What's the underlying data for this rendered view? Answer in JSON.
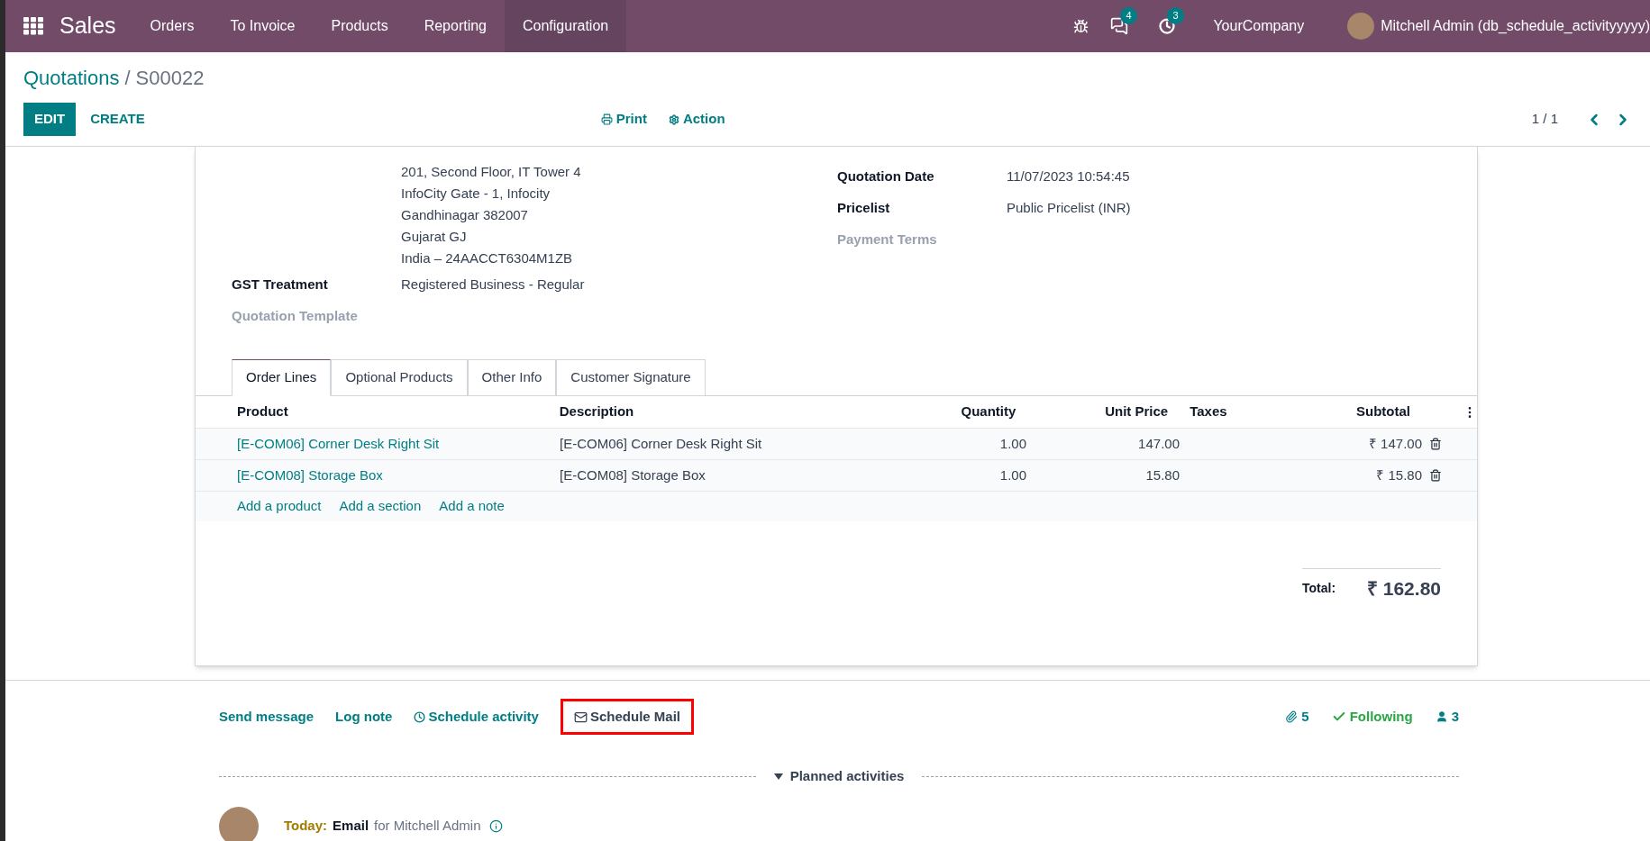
{
  "navbar": {
    "app": "Sales",
    "menu": [
      {
        "label": "Orders",
        "selected": false
      },
      {
        "label": "To Invoice",
        "selected": false
      },
      {
        "label": "Products",
        "selected": false
      },
      {
        "label": "Reporting",
        "selected": false
      },
      {
        "label": "Configuration",
        "selected": true
      }
    ],
    "messages_count": "4",
    "activities_count": "3",
    "company": "YourCompany",
    "user": "Mitchell Admin (db_schedule_activityyyyy)"
  },
  "breadcrumb": {
    "parent": "Quotations",
    "separator": "/",
    "current": "S00022"
  },
  "actions": {
    "edit": "EDIT",
    "create": "CREATE",
    "print": "Print",
    "action": "Action",
    "pager": "1 / 1"
  },
  "form": {
    "left": [
      {
        "kind": "address",
        "lines": [
          "201, Second Floor, IT Tower 4",
          "InfoCity Gate - 1, Infocity",
          "Gandhinagar 382007",
          "Gujarat GJ",
          "India – 24AACCT6304M1ZB"
        ]
      },
      {
        "label": "GST Treatment",
        "kind": "field",
        "value": "Registered Business - Regular"
      },
      {
        "label": "Quotation Template",
        "kind": "empty"
      }
    ],
    "right": [
      {
        "label": "Quotation Date",
        "kind": "field",
        "value": "11/07/2023 10:54:45"
      },
      {
        "label": "Pricelist",
        "kind": "field",
        "value": "Public Pricelist (INR)"
      },
      {
        "label": "Payment Terms",
        "kind": "empty"
      }
    ]
  },
  "tabs": [
    {
      "label": "Order Lines",
      "selected": true
    },
    {
      "label": "Optional Products",
      "selected": false
    },
    {
      "label": "Other Info",
      "selected": false
    },
    {
      "label": "Customer Signature",
      "selected": false
    }
  ],
  "table": {
    "columns": [
      "Product",
      "Description",
      "Quantity",
      "Unit Price",
      "Taxes",
      "Subtotal"
    ],
    "rows": [
      {
        "product": "[E-COM06] Corner Desk Right Sit",
        "description": "[E-COM06] Corner Desk Right Sit",
        "quantity": "1.00",
        "unit_price": "147.00",
        "subtotal": "₹ 147.00"
      },
      {
        "product": "[E-COM08] Storage Box",
        "description": "[E-COM08] Storage Box",
        "quantity": "1.00",
        "unit_price": "15.80",
        "subtotal": "₹ 15.80"
      }
    ],
    "add_links": [
      "Add a product",
      "Add a section",
      "Add a note"
    ]
  },
  "total": {
    "label": "Total:",
    "value": "₹ 162.80"
  },
  "chatter": {
    "buttons": [
      {
        "label": "Send message",
        "kind": "plain",
        "highlighted": false
      },
      {
        "label": "Log note",
        "kind": "plain",
        "highlighted": false
      },
      {
        "label": "Schedule activity",
        "kind": "clock",
        "highlighted": false
      },
      {
        "label": "Schedule Mail",
        "kind": "mail",
        "highlighted": true
      }
    ],
    "attachments": "5",
    "following": "Following",
    "followers": "3",
    "section": "Planned activities",
    "activity": {
      "when": "Today:",
      "type": "Email",
      "assignee": "for Mitchell Admin"
    }
  }
}
